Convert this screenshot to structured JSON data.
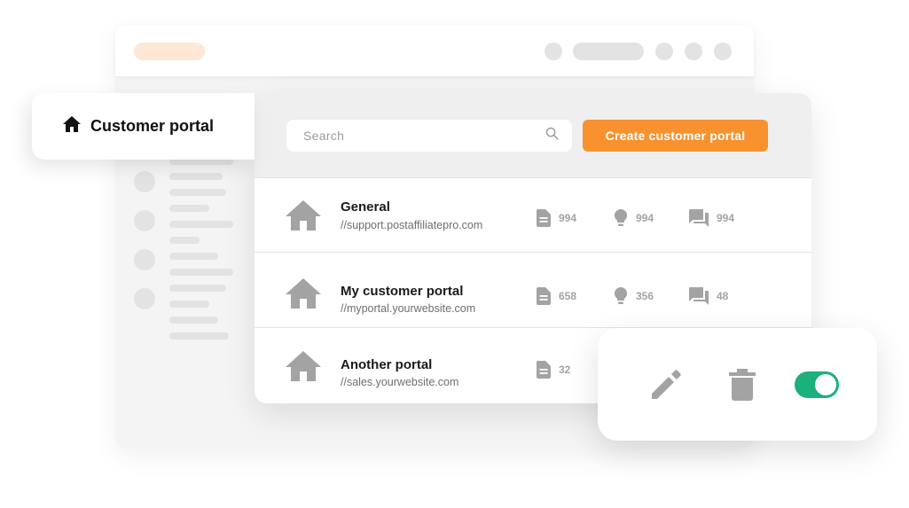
{
  "tag": {
    "title": "Customer portal",
    "icon": "home-icon"
  },
  "search": {
    "placeholder": "Search"
  },
  "toolbar": {
    "create_label": "Create customer portal"
  },
  "portals": [
    {
      "name": "General",
      "url": "//support.postaffiliatepro.com",
      "articles": "994",
      "ideas": "994",
      "comments": "994"
    },
    {
      "name": "My customer portal",
      "url": "//myportal.yourwebsite.com",
      "articles": "658",
      "ideas": "356",
      "comments": "48"
    },
    {
      "name": "Another portal",
      "url": "//sales.yourwebsite.com",
      "articles": "32"
    }
  ],
  "actions": {
    "toggle_enabled": true
  },
  "colors": {
    "accent": "#f7922f",
    "toggle_on": "#1bb17b",
    "icon_gray": "#a3a3a3"
  }
}
